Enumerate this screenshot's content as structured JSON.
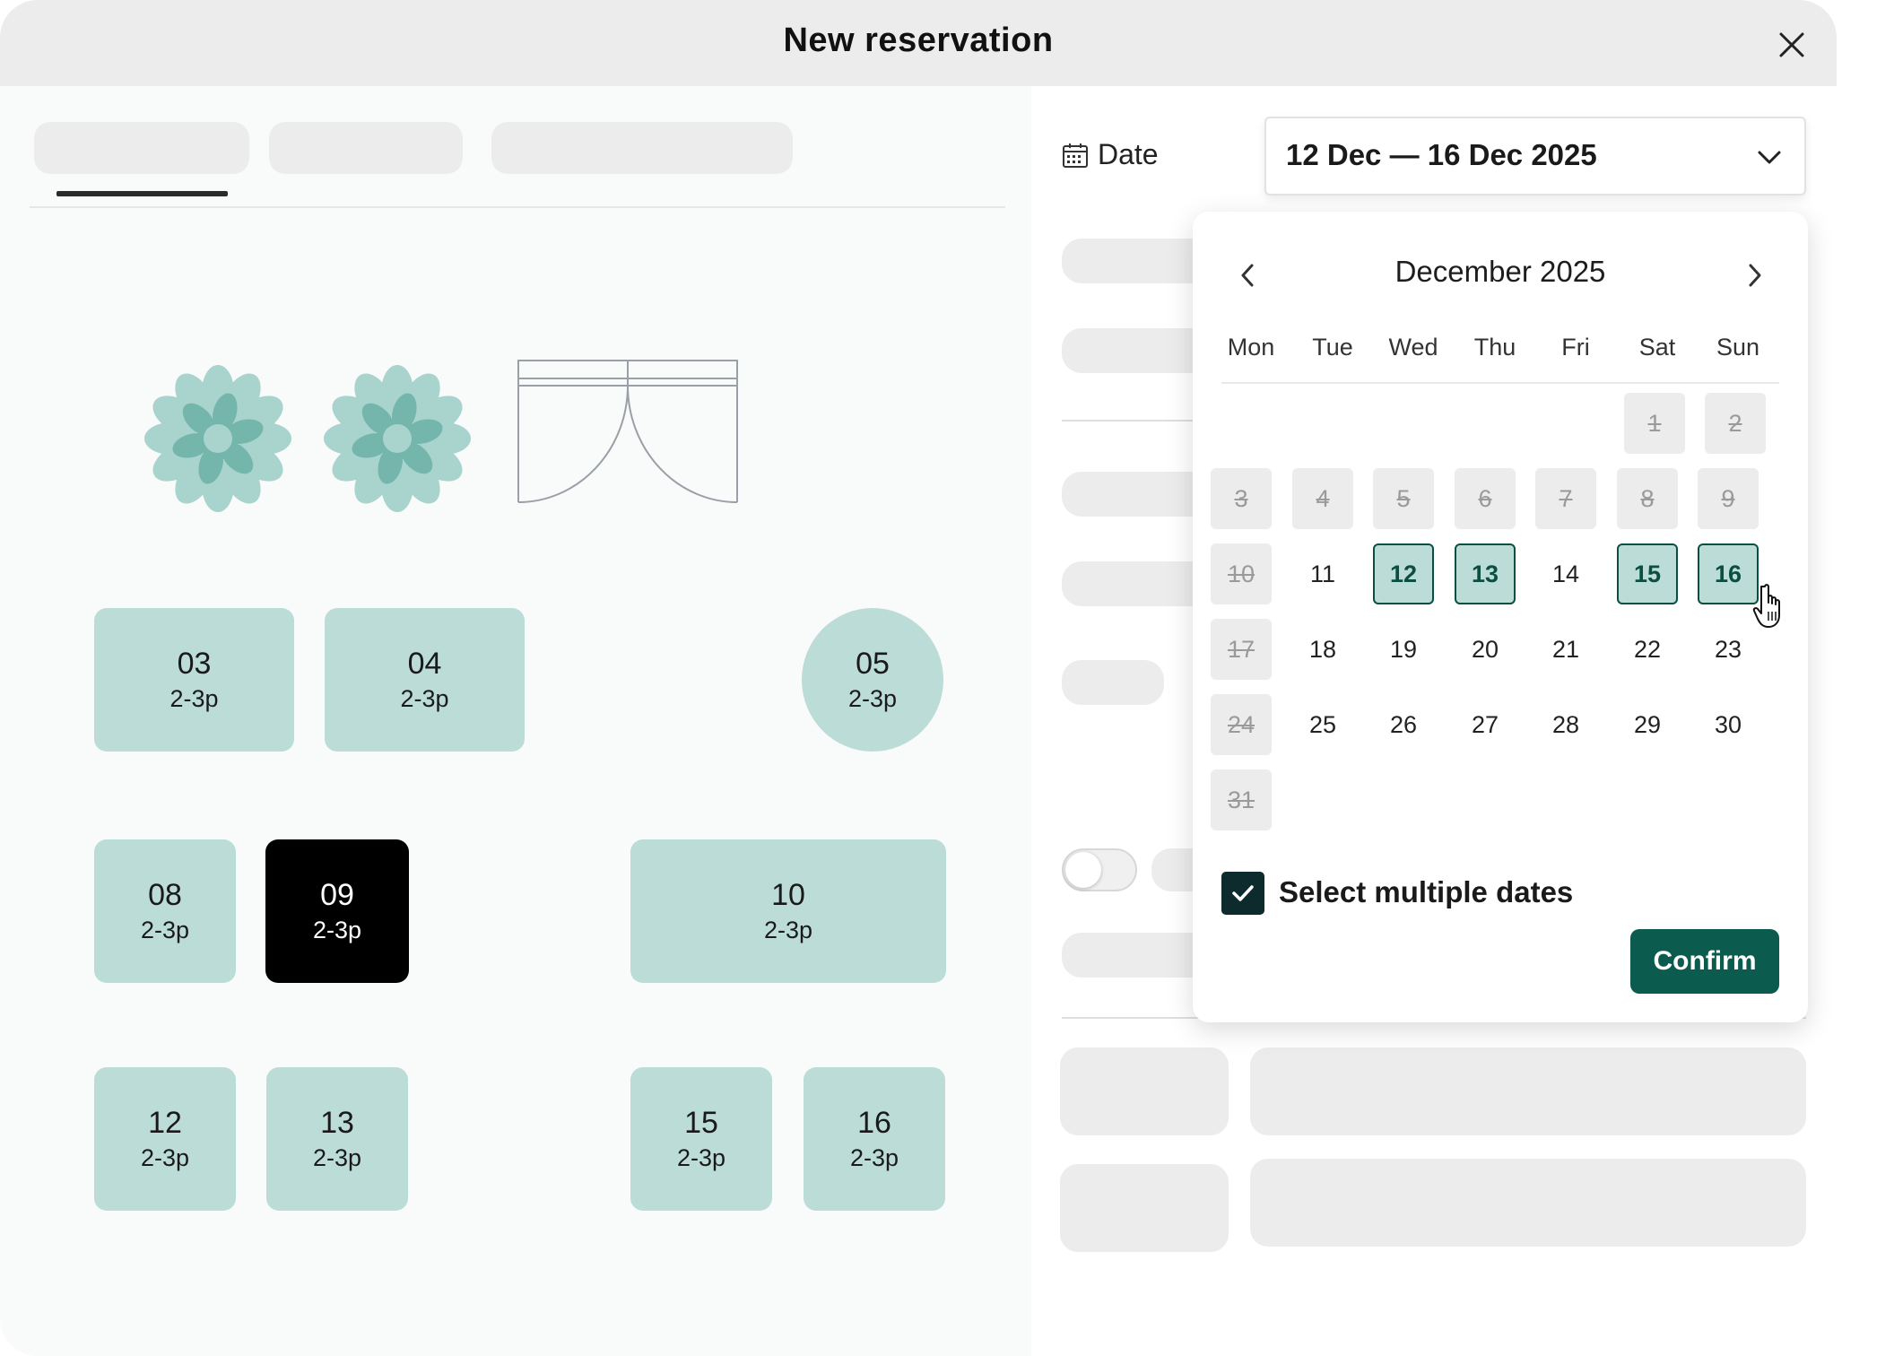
{
  "modal": {
    "title": "New reservation"
  },
  "date_field": {
    "label": "Date",
    "value": "12 Dec — 16 Dec 2025"
  },
  "floor_plan": {
    "tables": [
      {
        "num": "03",
        "time": "2-3p"
      },
      {
        "num": "04",
        "time": "2-3p"
      },
      {
        "num": "05",
        "time": "2-3p"
      },
      {
        "num": "08",
        "time": "2-3p"
      },
      {
        "num": "09",
        "time": "2-3p"
      },
      {
        "num": "10",
        "time": "2-3p"
      },
      {
        "num": "12",
        "time": "2-3p"
      },
      {
        "num": "13",
        "time": "2-3p"
      },
      {
        "num": "15",
        "time": "2-3p"
      },
      {
        "num": "16",
        "time": "2-3p"
      }
    ],
    "selected_table": "09"
  },
  "calendar": {
    "month": "December 2025",
    "weekdays": [
      "Mon",
      "Tue",
      "Wed",
      "Thu",
      "Fri",
      "Sat",
      "Sun"
    ],
    "days": [
      "1",
      "2",
      "3",
      "4",
      "5",
      "6",
      "7",
      "8",
      "9",
      "10",
      "11",
      "12",
      "13",
      "14",
      "15",
      "16",
      "17",
      "18",
      "19",
      "20",
      "21",
      "22",
      "23",
      "24",
      "25",
      "26",
      "27",
      "28",
      "29",
      "30",
      "31"
    ],
    "disabled_days": [
      1,
      2,
      3,
      4,
      5,
      6,
      7,
      8,
      9,
      10,
      17,
      24,
      31
    ],
    "selected_days": [
      12,
      13,
      15,
      16
    ],
    "multi_select_label": "Select multiple dates",
    "multi_select_checked": true,
    "confirm_label": "Confirm"
  },
  "colors": {
    "table": "#bcdcd8",
    "table_selected": "#000000",
    "accent": "#0b5c4e",
    "skeleton": "#ececed"
  }
}
